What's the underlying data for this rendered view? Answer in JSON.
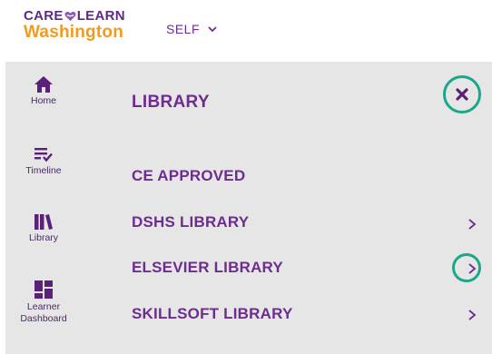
{
  "header": {
    "logo_line1_left": "CARE",
    "logo_line1_right": "LEARN",
    "logo_line2": "Washington",
    "self_label": "SELF"
  },
  "nav": {
    "items": [
      {
        "label": "Home",
        "icon": "home-icon"
      },
      {
        "label": "Timeline",
        "icon": "timeline-icon"
      },
      {
        "label": "Library",
        "icon": "library-icon"
      },
      {
        "label": "Learner Dashboard",
        "icon": "dashboard-icon"
      }
    ]
  },
  "menu": {
    "title": "LIBRARY",
    "items": [
      {
        "label": "CE APPROVED",
        "has_arrow": false
      },
      {
        "label": "DSHS LIBRARY",
        "has_arrow": true
      },
      {
        "label": "ELSEVIER LIBRARY",
        "has_arrow": true
      },
      {
        "label": "SKILLSOFT LIBRARY",
        "has_arrow": true
      }
    ]
  },
  "colors": {
    "purple": "#6d2c8f",
    "orange": "#f39a1e",
    "teal_highlight": "#1ba88a",
    "panel_bg": "#e6e6e6"
  }
}
